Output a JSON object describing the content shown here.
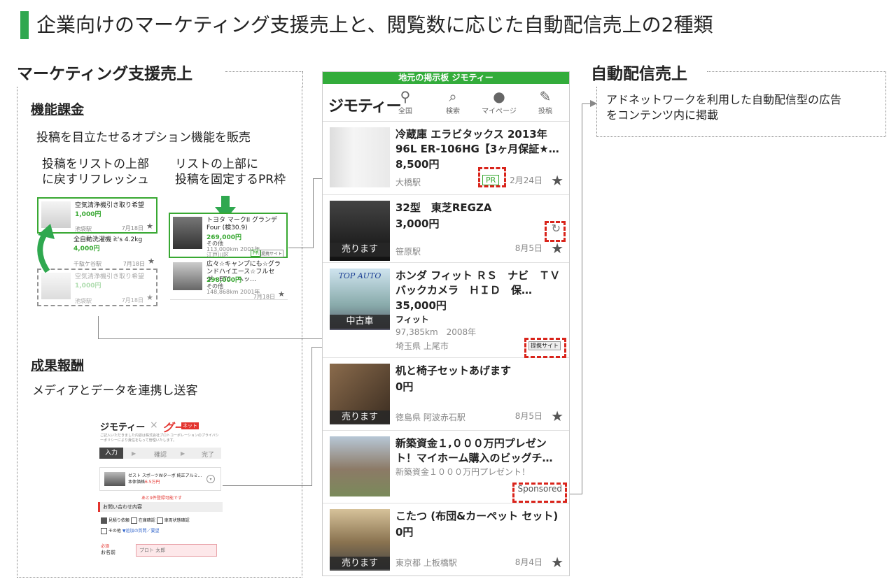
{
  "slide_title": "企業向けのマーケティング支援売上と、閲覧数に応じた自動配信売上の2種類",
  "left_section": {
    "heading": "マーケティング支援売上",
    "features": {
      "heading": "機能課金",
      "desc": "投稿を目立たせるオプション機能を販売",
      "refresh_label_1": "投稿をリストの上部",
      "refresh_label_2": "に戻すリフレッシュ",
      "pr_label_1": "リストの上部に",
      "pr_label_2": "投稿を固定するPR枠",
      "mini_items": [
        {
          "title": "空気清浄機引き取り希望",
          "price": "1,000円",
          "station": "池袋駅",
          "date": "7月18日"
        },
        {
          "title": "全自動洗濯機 it's 4.2kg",
          "price": "4,000円",
          "station": "千駄ケ谷駅",
          "date": "7月18日"
        },
        {
          "title": "空気清浄機引き取り希望",
          "price": "1,000円",
          "station": "池袋駅",
          "date": "7月18日"
        },
        {
          "title": "トヨタ マークII グランデFour (検30.9)",
          "price": "269,000円",
          "extra": "その他",
          "station": "113,000km 2001年",
          "date": "江戸川区"
        },
        {
          "title": "広々☆キャンプにも☆グランドハイエース☆フルセグ・ETC・ヘッ…",
          "price": "298,000円",
          "extra": "その他",
          "station": "148,868km 2001年",
          "date": "7月18日"
        }
      ],
      "pr_tag": "PR",
      "partner_tag": "提携サイト"
    },
    "performance": {
      "heading": "成果報酬",
      "desc": "メディアとデータを連携し送客"
    },
    "form": {
      "logo_left": "ジモティー",
      "times": "×",
      "logo_right": "グー",
      "logo_right_sub": "ネット",
      "notice": "ご記入いただきました内容は株式会社プロトコーポレーションのプライバシーポリシーにより責任をもって管理いたします。",
      "steps": [
        "入力",
        "▶",
        "確認",
        "▶",
        "完了"
      ],
      "car_name": "ゼスト スポーツWターボ 純正アルミ…",
      "car_price_label": "本体価格",
      "car_price": "6.5万円",
      "deadline": "あと9件登録可能です",
      "section": "お問い合わせ内容",
      "checks": [
        "見積り依頼",
        "在庫確認",
        "車両状態確認",
        "その他"
      ],
      "add_link": "▼追加の質問／要望",
      "required": "必須",
      "name_label": "お名前",
      "name_value": "プロト 太郎"
    }
  },
  "phone": {
    "top_bar": "地元の掲示板 ジモティー",
    "logo": "ジモティー",
    "nav": [
      {
        "icon": "⚲",
        "label": "全国"
      },
      {
        "icon": "⚲",
        "label": "検索"
      },
      {
        "icon": "●",
        "label": "マイページ"
      },
      {
        "icon": "✎",
        "label": "投稿"
      }
    ],
    "items": [
      {
        "title": "冷蔵庫 エラビタックス 2013年 96L ER-106HG【3ヶ月保証★…",
        "price": "8,500円",
        "station": "大橋駅",
        "date": "2月24日",
        "tag": "PR"
      },
      {
        "title": "32型　東芝REGZA",
        "price": "3,000円",
        "station": "笹原駅",
        "date": "8月5日",
        "badge": "売ります"
      },
      {
        "title": "ホンダ フィット ＲＳ　ナビ　ＴＶ　バックカメラ　ＨＩＤ　保…",
        "price": "35,000円",
        "sub1": "フィット",
        "sub2": "97,385km　2008年",
        "station": "埼玉県 上尾市",
        "badge": "中古車",
        "img_text": "TOP AUTO",
        "tag": "提携サイト"
      },
      {
        "title": "机と椅子セットあげます",
        "price": "0円",
        "station": "徳島県 阿波赤石駅",
        "date": "8月5日",
        "badge": "売ります"
      },
      {
        "title": "新築資金１,０００万円プレゼント！マイホーム購入のビッグチ…",
        "sub1": "新築資金１０００万円プレゼント！",
        "tag": "Sponsored"
      },
      {
        "title": "こたつ (布団&カーペット セット)",
        "price": "0円",
        "station": "東京都 上板橋駅",
        "date": "8月4日",
        "badge": "売ります"
      }
    ]
  },
  "right_section": {
    "heading": "自動配信売上",
    "desc_1": "アドネットワークを利用した自動配信型の広告",
    "desc_2": "をコンテンツ内に掲載"
  },
  "colors": {
    "accent": "#2fa84f",
    "highlight": "#d9241b"
  }
}
